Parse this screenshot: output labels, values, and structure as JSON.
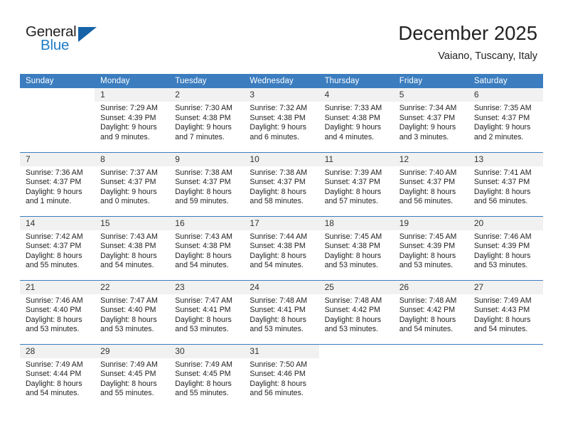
{
  "brand": {
    "name_top": "General",
    "name_bottom": "Blue",
    "color_dark": "#231f20",
    "color_blue": "#1f7cc4",
    "triangle_color": "#1663a8"
  },
  "header": {
    "title": "December 2025",
    "location": "Vaiano, Tuscany, Italy",
    "accent_color": "#3b7dbf"
  },
  "weekday_headers": [
    "Sunday",
    "Monday",
    "Tuesday",
    "Wednesday",
    "Thursday",
    "Friday",
    "Saturday"
  ],
  "labels": {
    "sunrise_prefix": "Sunrise:",
    "sunset_prefix": "Sunset:",
    "daylight_prefix": "Daylight:"
  },
  "weeks": [
    [
      {
        "day": "",
        "blank": true,
        "sunrise": "",
        "sunset": "",
        "daylight_line1": "",
        "daylight_line2": ""
      },
      {
        "day": "1",
        "blank": false,
        "sunrise": "Sunrise: 7:29 AM",
        "sunset": "Sunset: 4:39 PM",
        "daylight_line1": "Daylight: 9 hours",
        "daylight_line2": "and 9 minutes."
      },
      {
        "day": "2",
        "blank": false,
        "sunrise": "Sunrise: 7:30 AM",
        "sunset": "Sunset: 4:38 PM",
        "daylight_line1": "Daylight: 9 hours",
        "daylight_line2": "and 7 minutes."
      },
      {
        "day": "3",
        "blank": false,
        "sunrise": "Sunrise: 7:32 AM",
        "sunset": "Sunset: 4:38 PM",
        "daylight_line1": "Daylight: 9 hours",
        "daylight_line2": "and 6 minutes."
      },
      {
        "day": "4",
        "blank": false,
        "sunrise": "Sunrise: 7:33 AM",
        "sunset": "Sunset: 4:38 PM",
        "daylight_line1": "Daylight: 9 hours",
        "daylight_line2": "and 4 minutes."
      },
      {
        "day": "5",
        "blank": false,
        "sunrise": "Sunrise: 7:34 AM",
        "sunset": "Sunset: 4:37 PM",
        "daylight_line1": "Daylight: 9 hours",
        "daylight_line2": "and 3 minutes."
      },
      {
        "day": "6",
        "blank": false,
        "sunrise": "Sunrise: 7:35 AM",
        "sunset": "Sunset: 4:37 PM",
        "daylight_line1": "Daylight: 9 hours",
        "daylight_line2": "and 2 minutes."
      }
    ],
    [
      {
        "day": "7",
        "blank": false,
        "sunrise": "Sunrise: 7:36 AM",
        "sunset": "Sunset: 4:37 PM",
        "daylight_line1": "Daylight: 9 hours",
        "daylight_line2": "and 1 minute."
      },
      {
        "day": "8",
        "blank": false,
        "sunrise": "Sunrise: 7:37 AM",
        "sunset": "Sunset: 4:37 PM",
        "daylight_line1": "Daylight: 9 hours",
        "daylight_line2": "and 0 minutes."
      },
      {
        "day": "9",
        "blank": false,
        "sunrise": "Sunrise: 7:38 AM",
        "sunset": "Sunset: 4:37 PM",
        "daylight_line1": "Daylight: 8 hours",
        "daylight_line2": "and 59 minutes."
      },
      {
        "day": "10",
        "blank": false,
        "sunrise": "Sunrise: 7:38 AM",
        "sunset": "Sunset: 4:37 PM",
        "daylight_line1": "Daylight: 8 hours",
        "daylight_line2": "and 58 minutes."
      },
      {
        "day": "11",
        "blank": false,
        "sunrise": "Sunrise: 7:39 AM",
        "sunset": "Sunset: 4:37 PM",
        "daylight_line1": "Daylight: 8 hours",
        "daylight_line2": "and 57 minutes."
      },
      {
        "day": "12",
        "blank": false,
        "sunrise": "Sunrise: 7:40 AM",
        "sunset": "Sunset: 4:37 PM",
        "daylight_line1": "Daylight: 8 hours",
        "daylight_line2": "and 56 minutes."
      },
      {
        "day": "13",
        "blank": false,
        "sunrise": "Sunrise: 7:41 AM",
        "sunset": "Sunset: 4:37 PM",
        "daylight_line1": "Daylight: 8 hours",
        "daylight_line2": "and 56 minutes."
      }
    ],
    [
      {
        "day": "14",
        "blank": false,
        "sunrise": "Sunrise: 7:42 AM",
        "sunset": "Sunset: 4:37 PM",
        "daylight_line1": "Daylight: 8 hours",
        "daylight_line2": "and 55 minutes."
      },
      {
        "day": "15",
        "blank": false,
        "sunrise": "Sunrise: 7:43 AM",
        "sunset": "Sunset: 4:38 PM",
        "daylight_line1": "Daylight: 8 hours",
        "daylight_line2": "and 54 minutes."
      },
      {
        "day": "16",
        "blank": false,
        "sunrise": "Sunrise: 7:43 AM",
        "sunset": "Sunset: 4:38 PM",
        "daylight_line1": "Daylight: 8 hours",
        "daylight_line2": "and 54 minutes."
      },
      {
        "day": "17",
        "blank": false,
        "sunrise": "Sunrise: 7:44 AM",
        "sunset": "Sunset: 4:38 PM",
        "daylight_line1": "Daylight: 8 hours",
        "daylight_line2": "and 54 minutes."
      },
      {
        "day": "18",
        "blank": false,
        "sunrise": "Sunrise: 7:45 AM",
        "sunset": "Sunset: 4:38 PM",
        "daylight_line1": "Daylight: 8 hours",
        "daylight_line2": "and 53 minutes."
      },
      {
        "day": "19",
        "blank": false,
        "sunrise": "Sunrise: 7:45 AM",
        "sunset": "Sunset: 4:39 PM",
        "daylight_line1": "Daylight: 8 hours",
        "daylight_line2": "and 53 minutes."
      },
      {
        "day": "20",
        "blank": false,
        "sunrise": "Sunrise: 7:46 AM",
        "sunset": "Sunset: 4:39 PM",
        "daylight_line1": "Daylight: 8 hours",
        "daylight_line2": "and 53 minutes."
      }
    ],
    [
      {
        "day": "21",
        "blank": false,
        "sunrise": "Sunrise: 7:46 AM",
        "sunset": "Sunset: 4:40 PM",
        "daylight_line1": "Daylight: 8 hours",
        "daylight_line2": "and 53 minutes."
      },
      {
        "day": "22",
        "blank": false,
        "sunrise": "Sunrise: 7:47 AM",
        "sunset": "Sunset: 4:40 PM",
        "daylight_line1": "Daylight: 8 hours",
        "daylight_line2": "and 53 minutes."
      },
      {
        "day": "23",
        "blank": false,
        "sunrise": "Sunrise: 7:47 AM",
        "sunset": "Sunset: 4:41 PM",
        "daylight_line1": "Daylight: 8 hours",
        "daylight_line2": "and 53 minutes."
      },
      {
        "day": "24",
        "blank": false,
        "sunrise": "Sunrise: 7:48 AM",
        "sunset": "Sunset: 4:41 PM",
        "daylight_line1": "Daylight: 8 hours",
        "daylight_line2": "and 53 minutes."
      },
      {
        "day": "25",
        "blank": false,
        "sunrise": "Sunrise: 7:48 AM",
        "sunset": "Sunset: 4:42 PM",
        "daylight_line1": "Daylight: 8 hours",
        "daylight_line2": "and 53 minutes."
      },
      {
        "day": "26",
        "blank": false,
        "sunrise": "Sunrise: 7:48 AM",
        "sunset": "Sunset: 4:42 PM",
        "daylight_line1": "Daylight: 8 hours",
        "daylight_line2": "and 54 minutes."
      },
      {
        "day": "27",
        "blank": false,
        "sunrise": "Sunrise: 7:49 AM",
        "sunset": "Sunset: 4:43 PM",
        "daylight_line1": "Daylight: 8 hours",
        "daylight_line2": "and 54 minutes."
      }
    ],
    [
      {
        "day": "28",
        "blank": false,
        "sunrise": "Sunrise: 7:49 AM",
        "sunset": "Sunset: 4:44 PM",
        "daylight_line1": "Daylight: 8 hours",
        "daylight_line2": "and 54 minutes."
      },
      {
        "day": "29",
        "blank": false,
        "sunrise": "Sunrise: 7:49 AM",
        "sunset": "Sunset: 4:45 PM",
        "daylight_line1": "Daylight: 8 hours",
        "daylight_line2": "and 55 minutes."
      },
      {
        "day": "30",
        "blank": false,
        "sunrise": "Sunrise: 7:49 AM",
        "sunset": "Sunset: 4:45 PM",
        "daylight_line1": "Daylight: 8 hours",
        "daylight_line2": "and 55 minutes."
      },
      {
        "day": "31",
        "blank": false,
        "sunrise": "Sunrise: 7:50 AM",
        "sunset": "Sunset: 4:46 PM",
        "daylight_line1": "Daylight: 8 hours",
        "daylight_line2": "and 56 minutes."
      },
      {
        "day": "",
        "blank": true,
        "sunrise": "",
        "sunset": "",
        "daylight_line1": "",
        "daylight_line2": ""
      },
      {
        "day": "",
        "blank": true,
        "sunrise": "",
        "sunset": "",
        "daylight_line1": "",
        "daylight_line2": ""
      },
      {
        "day": "",
        "blank": true,
        "sunrise": "",
        "sunset": "",
        "daylight_line1": "",
        "daylight_line2": ""
      }
    ]
  ]
}
